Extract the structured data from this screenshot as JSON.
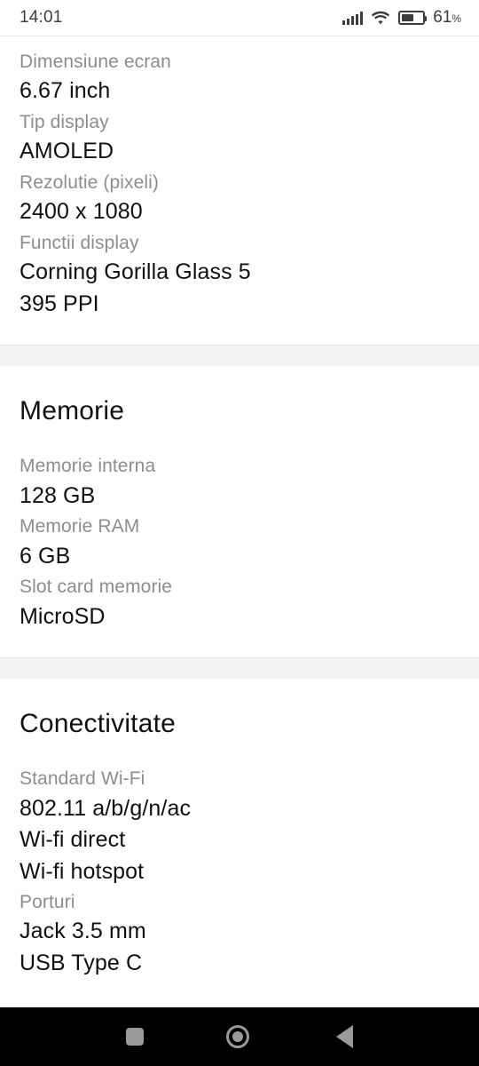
{
  "statusbar": {
    "time": "14:01",
    "battery_percent": "61",
    "percent_symbol": "%",
    "signal_icon": "signal-bars-icon",
    "wifi_icon": "wifi-icon",
    "battery_icon": "battery-icon"
  },
  "sections": [
    {
      "title": "",
      "specs": [
        {
          "label": "Dimensiune ecran",
          "values": [
            "6.67 inch"
          ]
        },
        {
          "label": "Tip display",
          "values": [
            "AMOLED"
          ]
        },
        {
          "label": "Rezolutie (pixeli)",
          "values": [
            "2400 x 1080"
          ]
        },
        {
          "label": "Functii display",
          "values": [
            "Corning Gorilla Glass 5",
            "395 PPI"
          ]
        }
      ]
    },
    {
      "title": "Memorie",
      "specs": [
        {
          "label": "Memorie interna",
          "values": [
            "128 GB"
          ]
        },
        {
          "label": "Memorie RAM",
          "values": [
            "6 GB"
          ]
        },
        {
          "label": "Slot card memorie",
          "values": [
            "MicroSD"
          ]
        }
      ]
    },
    {
      "title": "Conectivitate",
      "specs": [
        {
          "label": "Standard Wi-Fi",
          "values": [
            "802.11 a/b/g/n/ac",
            "Wi-fi direct",
            "Wi-fi hotspot"
          ]
        },
        {
          "label": "Porturi",
          "values": [
            "Jack 3.5 mm",
            "USB Type C"
          ]
        }
      ]
    }
  ],
  "navbar": {
    "recents_label": "recents-button",
    "home_label": "home-button",
    "back_label": "back-button"
  },
  "colors": {
    "label": "#8d8d8d",
    "value": "#111111",
    "divider": "#f2f2f2",
    "nav_icon": "#9a9a9a"
  }
}
